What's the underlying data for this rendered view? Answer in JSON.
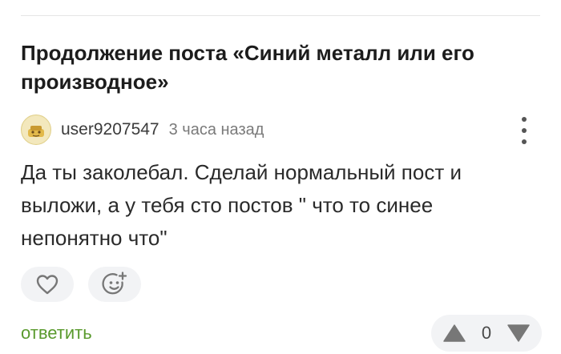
{
  "post": {
    "title": "Продолжение поста «Синий металл или его производное»"
  },
  "comment": {
    "author": "user9207547",
    "time": "3 часа назад",
    "text": "Да ты заколебал. Сделай нормальный пост и выложи, а у тебя сто постов \" что то синее непонятно что\"",
    "avatar_icon": "avatar-icon",
    "more_icon": "more-vertical-icon"
  },
  "actions": {
    "like_icon": "heart-icon",
    "emoji_icon": "add-emoji-icon",
    "reply_label": "ответить",
    "rating": "0",
    "upvote_icon": "triangle-up-icon",
    "downvote_icon": "triangle-down-icon"
  },
  "colors": {
    "reply_link": "#5a9a2e",
    "pill_background": "#f2f3f5",
    "icon_gray": "#777777"
  }
}
